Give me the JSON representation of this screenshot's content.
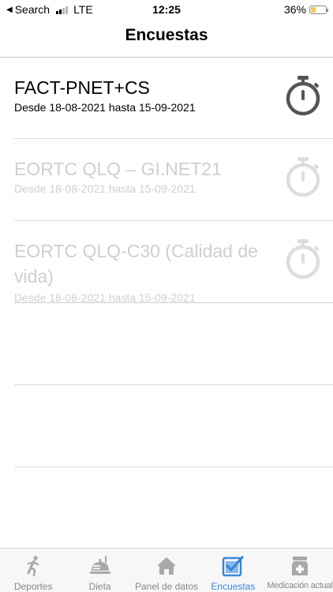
{
  "status_bar": {
    "back_label": "Search",
    "network": "LTE",
    "time": "12:25",
    "battery_percent": "36%",
    "battery_level": 0.36,
    "signal_bars_active": 2
  },
  "nav": {
    "title": "Encuestas"
  },
  "surveys": [
    {
      "title": "FACT-PNET+CS",
      "dates": "Desde 18-08-2021 hasta 15-09-2021",
      "enabled": true
    },
    {
      "title": "EORTC QLQ – GI.NET21",
      "dates": "Desde 18-08-2021 hasta 15-09-2021",
      "enabled": false
    },
    {
      "title": "EORTC QLQ-C30 (Calidad de vida)",
      "dates": "Desde 18-08-2021 hasta 15-09-2021",
      "enabled": false
    }
  ],
  "tab_bar": {
    "active": "Encuestas",
    "tabs": [
      {
        "label": "Deportes",
        "icon": "running-person-icon"
      },
      {
        "label": "Dieta",
        "icon": "food-tray-icon"
      },
      {
        "label": "Panel de datos",
        "icon": "house-icon"
      },
      {
        "label": "Encuestas",
        "icon": "checkbox-icon"
      },
      {
        "label": "Medicación actual",
        "icon": "medicine-bottle-icon"
      }
    ]
  },
  "colors": {
    "accent": "#3a86d9",
    "inactive_tab": "#888888",
    "disabled_text": "#cfcfcf",
    "timer_active": "#555555",
    "timer_disabled": "#dddddd",
    "battery_fill": "#f7c948"
  }
}
